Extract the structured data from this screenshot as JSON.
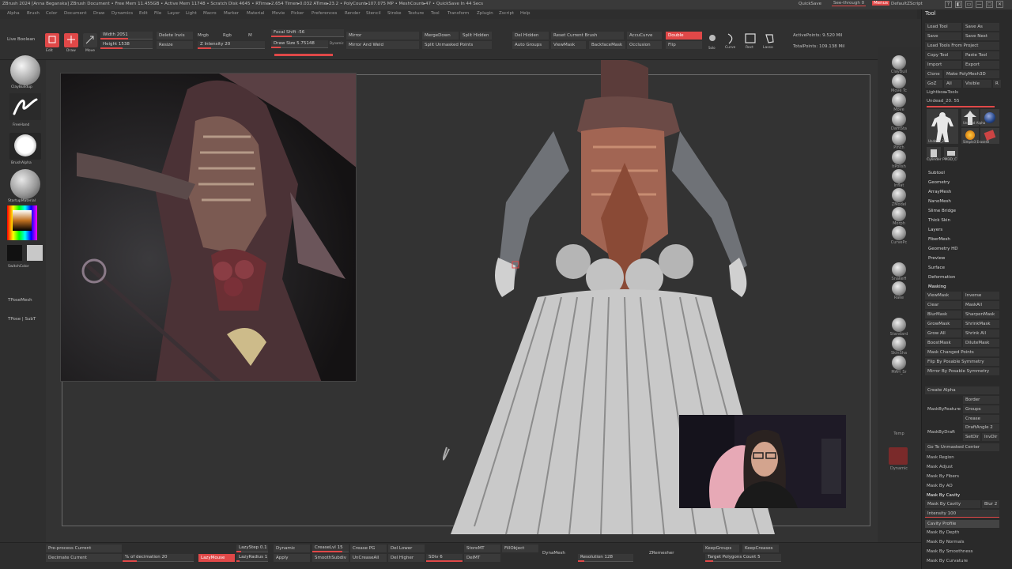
{
  "title_bar": {
    "title": "ZBrush 2024 [Anna Beganska]   ZBrush Document    • Free Mem 11.455GB • Active Mem 11748 • Scratch Disk 4645 • RTime▸2.654 Timer▸0.032 ATime▸23.2 • PolyCount▸107.075 MP • MeshCount▸47 • QuickSave In 44 Secs",
    "quicksave": "QuickSave",
    "see_through": "See-through 0",
    "menus": "Menus",
    "default_zscript": "DefaultZScript",
    "win_buttons": [
      "?",
      "◧",
      "▭",
      "—",
      "▢",
      "✕"
    ]
  },
  "menu_bar": {
    "items": [
      "Alpha",
      "Brush",
      "Color",
      "Document",
      "Draw",
      "Dynamics",
      "Edit",
      "File",
      "Layer",
      "Light",
      "Macro",
      "Marker",
      "Material",
      "Movie",
      "Picker",
      "Preferences",
      "Render",
      "Stencil",
      "Stroke",
      "Texture",
      "Tool",
      "Transform",
      "Zplugin",
      "Zscript",
      "Help"
    ]
  },
  "top_shelf": {
    "live_boolean": "Live Boolean",
    "edit": "Edit",
    "draw": "Draw",
    "move": "Move",
    "width": "Width 2051",
    "height": "Height 1538",
    "delete_invis": "Delete Invis",
    "resize": "Resize",
    "mrgb": "Mrgb",
    "rgb": "Rgb",
    "m": "M",
    "z_intensity": "Z Intensity 20",
    "focal_shift": "Focal Shift -56",
    "draw_size": "Draw Size 5.75148",
    "dynamic": "Dynamic",
    "mirror": "Mirror",
    "mirror_and_weld": "Mirror And Weld",
    "merge_down": "MergeDown",
    "split_hidden": "Split Hidden",
    "split_unmasked": "Split Unmasked Points",
    "del_hidden": "Del Hidden",
    "auto_groups": "Auto Groups",
    "reset_current_brush": "Reset Current Brush",
    "view_mask": "ViewMask",
    "accu_curve": "AccuCurve",
    "backface_mask": "BackfaceMask",
    "occlusion": "Occlusion",
    "double": "Double",
    "flip": "Flip",
    "solo": "Solo",
    "curve": "Curve",
    "rect": "Rect",
    "lasso": "Lasso",
    "active_points": "ActivePoints: 9.520 Mil",
    "total_points": "TotalPoints: 109.138 Mil"
  },
  "left_shelf": {
    "clay_buildup": "ClayBuildup",
    "freehand": "FreeHand",
    "brush_alpha": "BrushAlpha",
    "startup_material": "StartupMaterial",
    "switch_color": "SwitchColor",
    "tpose_mesh": "TPoseMesh",
    "tpose_subt": "TPose | SubT"
  },
  "right_shelf": {
    "items": [
      "ClayBuil",
      "Move Tc",
      "Move",
      "DamSta",
      "Pinch",
      "hPolish",
      "Inflat",
      "ZModel",
      "Morph",
      "CurvePc",
      "SnakeH",
      "Rake",
      "Standard",
      "SkinSha",
      "MAH_Sr",
      "Temp",
      "Dynamic"
    ]
  },
  "tool_panel": {
    "header": "Tool",
    "load_tool": "Load Tool",
    "save_as": "Save As",
    "save": "Save",
    "save_next": "Save Next",
    "load_tools_from_project": "Load Tools From Project",
    "copy_tool": "Copy Tool",
    "paste_tool": "Paste Tool",
    "import": "Import",
    "export": "Export",
    "clone": "Clone",
    "make_polymesh": "Make PolyMesh3D",
    "goz": "GoZ",
    "all": "All",
    "visible": "Visible",
    "r": "R",
    "lightbox_tools": "Lightbox▸Tools",
    "current_tool": "Undead_20. 55",
    "thumb_labels": [
      "Undead_20",
      "Cylinder PM3D_C",
      "Simple3 EraserB",
      "Undead Alpha"
    ],
    "sections": [
      "Subtool",
      "Geometry",
      "ArrayMesh",
      "NanoMesh",
      "Slime Bridge",
      "Thick Skin",
      "Layers",
      "FiberMesh",
      "Geometry HD",
      "Preview",
      "Surface",
      "Deformation",
      "Masking"
    ],
    "masking": {
      "view_mask": "ViewMask",
      "inverse": "Inverse",
      "clear": "Clear",
      "mask_all": "MaskAll",
      "blur_mask": "BlurMask",
      "sharpen_mask": "SharpenMask",
      "grow_mask": "GrowMask",
      "shrink_mask": "ShrinkMask",
      "grow_all": "Grow All",
      "shrink_all": "Shrink All",
      "boost_mask": "BoostMask",
      "dilute_mask": "DiluteMask",
      "mask_changed_points": "Mask Changed Points",
      "flip_sym": "Flip By Posable Symmetry",
      "mirror_sym": "Mirror By Posable Symmetry",
      "create_alpha": "Create Alpha",
      "mask_by_feature": "MaskByFeature",
      "border": "Border",
      "groups": "Groups",
      "crease": "Crease",
      "mask_by_draft": "MaskByDraft",
      "draft_angle": "DraftAngle 2",
      "set_dir": "SetDir",
      "inv_dir": "InvDir",
      "go_to_unmasked": "Go To Unmasked Center",
      "mask_region": "Mask Region",
      "mask_adjust": "Mask Adjust",
      "mask_by_fibers": "Mask By Fibers",
      "mask_by_ao": "Mask By AO",
      "mask_by_cavity": "Mask By Cavity",
      "mask_by_cavity_btn": "Mask By Cavity",
      "blur": "Blur 2",
      "intensity": "Intensity 100",
      "cavity_profile": "Cavity Profile",
      "mask_by_depth": "Mask By Depth",
      "mask_by_normals": "Mask By Normals",
      "mask_by_smoothness": "Mask By Smoothness",
      "mask_by_curvature": "Mask By Curvature"
    }
  },
  "bottom_shelf": {
    "preprocess_current": "Pre-process Current",
    "decimate_current": "Decimate Current",
    "pct_decimation": "% of decimation 20",
    "lazy_mouse": "LazyMouse",
    "lazy_step": "LazyStep 0.1",
    "lazy_radius": "LazyRadius 1",
    "dynamic": "Dynamic",
    "apply": "Apply",
    "crease_lvl": "CreaseLvl 15",
    "smooth_subdiv": "SmoothSubdiv",
    "crease_pg": "Crease PG",
    "uncrease_all": "UnCreaseAll",
    "del_lower": "Del Lower",
    "del_higher": "Del Higher",
    "sdiv": "SDiv 6",
    "store_mt": "StoreMT",
    "del_mt": "DelMT",
    "fill_object": "FillObject",
    "dynamesh": "DynaMesh",
    "resolution": "Resolution 128",
    "zremesher": "ZRemesher",
    "keep_groups": "KeepGroups",
    "keep_creases": "KeepCreases",
    "target_polygons": "Target Polygons Count 5"
  },
  "colors": {
    "accent": "#e04848",
    "panel": "#2f2f2f",
    "canvas": "#333333"
  }
}
